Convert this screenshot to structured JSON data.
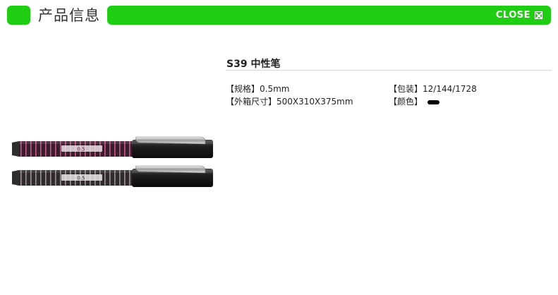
{
  "header": {
    "title": "产品信息",
    "close_label": "CLOSE",
    "accent_color": "#1fcd12"
  },
  "product": {
    "name": "S39 中性笔",
    "specs": {
      "size_label": "【规格】",
      "size_value": "0.5mm",
      "package_label": "【包装】",
      "package_value": "12/144/1728",
      "carton_label": "【外箱尺寸】",
      "carton_value": "500X310X375mm",
      "color_label": "【颜色】",
      "color_value": "#000000"
    },
    "image": {
      "icon": "gel-pen-photo",
      "pen1_print": "0.5",
      "pen2_print": "0.5"
    }
  }
}
